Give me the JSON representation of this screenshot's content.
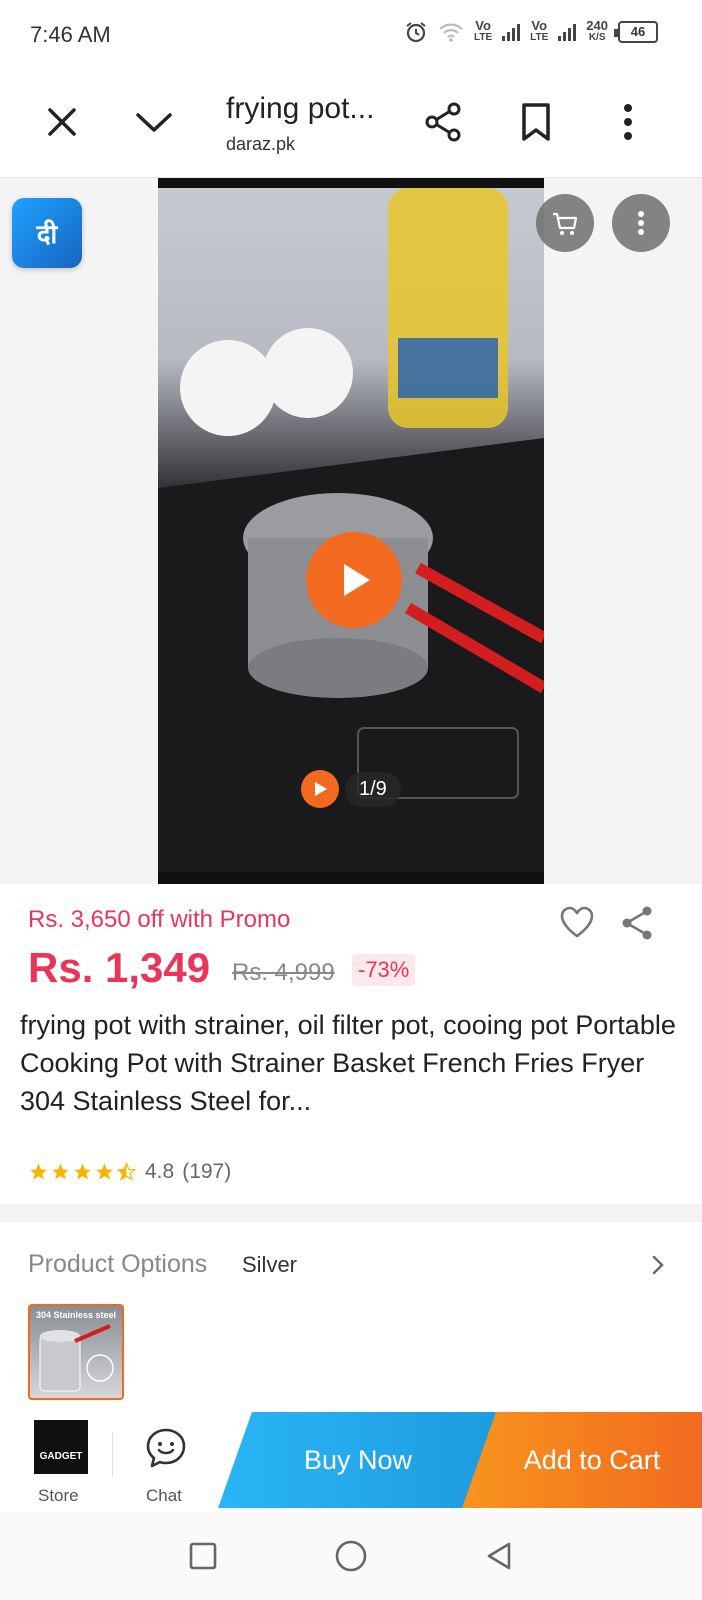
{
  "status_bar": {
    "time": "7:46 AM",
    "network1": "Vo",
    "network1_sub": "LTE",
    "network2": "Vo",
    "network2_sub": "LTE",
    "speed": "240",
    "speed_unit": "K/S",
    "battery": "46"
  },
  "browser": {
    "title": "frying pot...",
    "url": "daraz.pk"
  },
  "media": {
    "counter": "1/9",
    "app_logo_text": "दी"
  },
  "product": {
    "promo_text": "Rs. 3,650 off with Promo",
    "price": "Rs. 1,349",
    "original_price": "Rs. 4,999",
    "discount": "-73%",
    "title": "frying pot with strainer, oil filter pot, cooing pot Portable Cooking Pot with Strainer Basket French Fries Fryer 304 Stainless Steel for...",
    "rating": "4.8",
    "review_count": "(197)",
    "stars": 4.5
  },
  "options": {
    "label": "Product Options",
    "selected": "Silver",
    "thumb_text": "304 Stainless steel"
  },
  "action_bar": {
    "store_label": "Store",
    "store_logo_text": "GADGET",
    "chat_label": "Chat",
    "buy_now": "Buy Now",
    "add_to_cart": "Add to Cart"
  },
  "colors": {
    "accent": "#f26a1f",
    "price": "#e8365a",
    "buy_now": "#1e9be0"
  }
}
